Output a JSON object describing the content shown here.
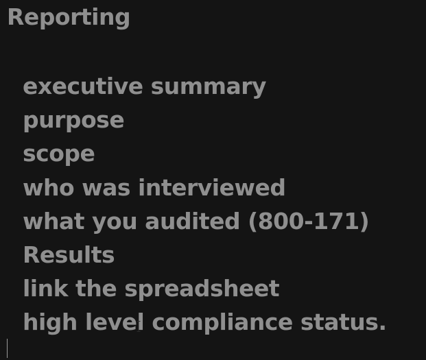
{
  "document": {
    "heading": "Reporting",
    "items": [
      "executive summary",
      "purpose",
      "scope",
      "who was interviewed",
      "what you audited (800-171)",
      "Results",
      "link the spreadsheet",
      "high level compliance status."
    ]
  },
  "icons": {
    "mouse_pointer": "ibeam-cursor-icon",
    "caret": "text-caret"
  },
  "colors": {
    "background": "#141414",
    "text": "#8f8f8f"
  }
}
